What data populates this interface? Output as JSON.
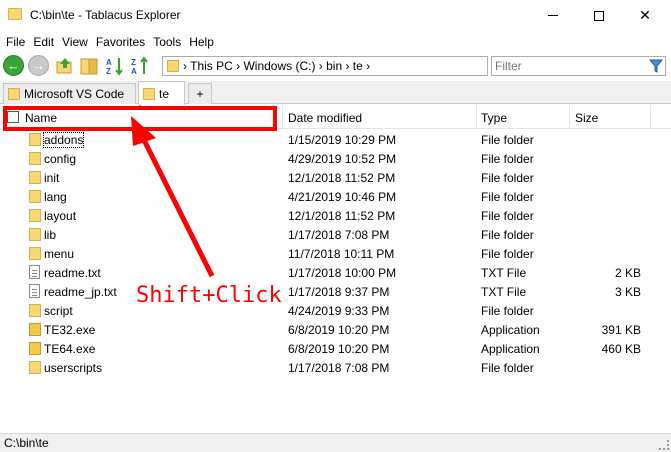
{
  "window": {
    "title": "C:\\bin\\te - Tablacus Explorer"
  },
  "menu": {
    "items": [
      "File",
      "Edit",
      "View",
      "Favorites",
      "Tools",
      "Help"
    ],
    "underline": [
      "F",
      "E",
      "V",
      "a",
      "T",
      "H"
    ]
  },
  "toolbar": {
    "breadcrumb": "› This PC › Windows (C:) › bin › te ›",
    "filter_placeholder": "Filter"
  },
  "tabs": [
    {
      "label": "Microsoft VS Code"
    },
    {
      "label": "te"
    },
    {
      "label": "+"
    }
  ],
  "columns": {
    "name": "Name",
    "date": "Date modified",
    "type": "Type",
    "size": "Size"
  },
  "rows": [
    {
      "name": "addons",
      "date": "1/15/2019 10:29 PM",
      "type": "File folder",
      "size": "",
      "kind": "folder"
    },
    {
      "name": "config",
      "date": "4/29/2019 10:52 PM",
      "type": "File folder",
      "size": "",
      "kind": "folder"
    },
    {
      "name": "init",
      "date": "12/1/2018 11:52 PM",
      "type": "File folder",
      "size": "",
      "kind": "folder"
    },
    {
      "name": "lang",
      "date": "4/21/2019 10:46 PM",
      "type": "File folder",
      "size": "",
      "kind": "folder"
    },
    {
      "name": "layout",
      "date": "12/1/2018 11:52 PM",
      "type": "File folder",
      "size": "",
      "kind": "folder"
    },
    {
      "name": "lib",
      "date": "1/17/2018 7:08 PM",
      "type": "File folder",
      "size": "",
      "kind": "folder"
    },
    {
      "name": "menu",
      "date": "11/7/2018 10:11 PM",
      "type": "File folder",
      "size": "",
      "kind": "folder"
    },
    {
      "name": "readme.txt",
      "date": "1/17/2018 10:00 PM",
      "type": "TXT File",
      "size": "2 KB",
      "kind": "file"
    },
    {
      "name": "readme_jp.txt",
      "date": "1/17/2018 9:37 PM",
      "type": "TXT File",
      "size": "3 KB",
      "kind": "file"
    },
    {
      "name": "script",
      "date": "4/24/2019 9:33 PM",
      "type": "File folder",
      "size": "",
      "kind": "folder"
    },
    {
      "name": "TE32.exe",
      "date": "6/8/2019 10:20 PM",
      "type": "Application",
      "size": "391 KB",
      "kind": "exe"
    },
    {
      "name": "TE64.exe",
      "date": "6/8/2019 10:20 PM",
      "type": "Application",
      "size": "460 KB",
      "kind": "exe"
    },
    {
      "name": "userscripts",
      "date": "1/17/2018 7:08 PM",
      "type": "File folder",
      "size": "",
      "kind": "folder"
    }
  ],
  "status": {
    "path": "C:\\bin\\te"
  },
  "annotation": {
    "text": "Shift+Click",
    "color": "#ff0000"
  },
  "icons": {
    "back": "back-arrow-icon",
    "forward": "forward-arrow-icon",
    "up": "up-folder-icon",
    "filter": "funnel-icon"
  }
}
